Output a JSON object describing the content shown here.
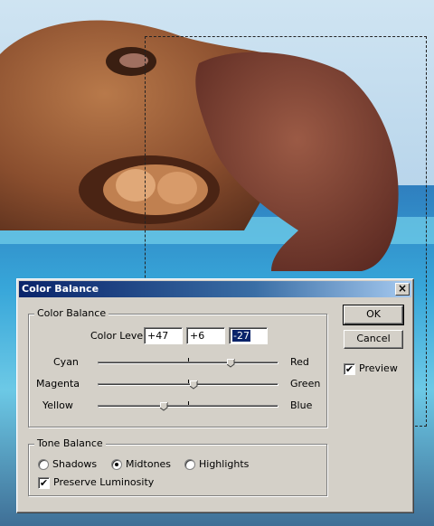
{
  "dialog": {
    "title": "Color Balance",
    "close_label": "×",
    "color_balance_group": "Color Balance",
    "color_levels_label": "Color Levels:",
    "levels": [
      "+47",
      "+6",
      "-27"
    ],
    "sliders": [
      {
        "left": "Cyan",
        "right": "Red",
        "value": 47
      },
      {
        "left": "Magenta",
        "right": "Green",
        "value": 6
      },
      {
        "left": "Yellow",
        "right": "Blue",
        "value": -27
      }
    ],
    "tone_balance_group": "Tone Balance",
    "tones": {
      "shadows": "Shadows",
      "midtones": "Midtones",
      "highlights": "Highlights"
    },
    "selected_tone": "Midtones",
    "preserve_luminosity": "Preserve Luminosity",
    "preserve_checked": true
  },
  "buttons": {
    "ok": "OK",
    "cancel": "Cancel"
  },
  "preview": {
    "label": "Preview",
    "checked": true
  },
  "check_mark": "✔"
}
